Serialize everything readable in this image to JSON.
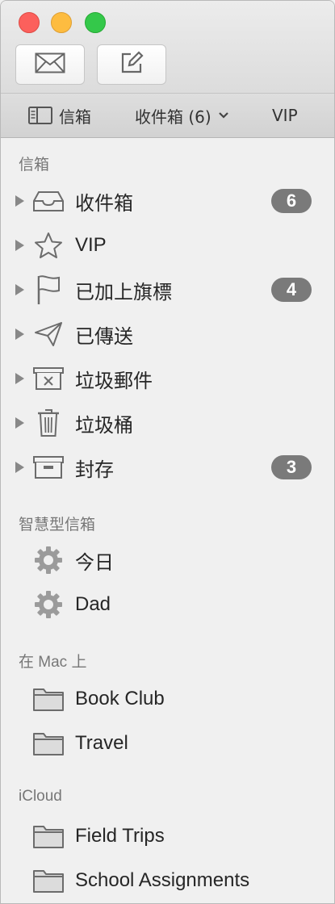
{
  "toolbar": {
    "mailboxes_label": "信箱",
    "inbox_label": "收件箱 (6)",
    "vip_label": "VIP"
  },
  "sections": {
    "mailboxes": "信箱",
    "smart": "智慧型信箱",
    "onmac": "在 Mac 上",
    "icloud": "iCloud"
  },
  "mailboxes": [
    {
      "label": "收件箱",
      "icon": "inbox-icon",
      "badge": "6"
    },
    {
      "label": "VIP",
      "icon": "star-icon",
      "badge": ""
    },
    {
      "label": "已加上旗標",
      "icon": "flag-icon",
      "badge": "4"
    },
    {
      "label": "已傳送",
      "icon": "sent-icon",
      "badge": ""
    },
    {
      "label": "垃圾郵件",
      "icon": "junk-icon",
      "badge": ""
    },
    {
      "label": "垃圾桶",
      "icon": "trash-icon",
      "badge": ""
    },
    {
      "label": "封存",
      "icon": "archive-icon",
      "badge": "3"
    }
  ],
  "smart_mailboxes": [
    {
      "label": "今日",
      "icon": "gear-icon"
    },
    {
      "label": "Dad",
      "icon": "gear-icon"
    }
  ],
  "on_mac": [
    {
      "label": "Book Club",
      "icon": "folder-icon"
    },
    {
      "label": "Travel",
      "icon": "folder-icon"
    }
  ],
  "icloud": [
    {
      "label": "Field Trips",
      "icon": "folder-icon"
    },
    {
      "label": "School Assignments",
      "icon": "folder-icon"
    }
  ],
  "colors": {
    "close": "#fc605c",
    "minimize": "#fdbc40",
    "zoom": "#34c84a",
    "badge": "#7a7a7a"
  }
}
